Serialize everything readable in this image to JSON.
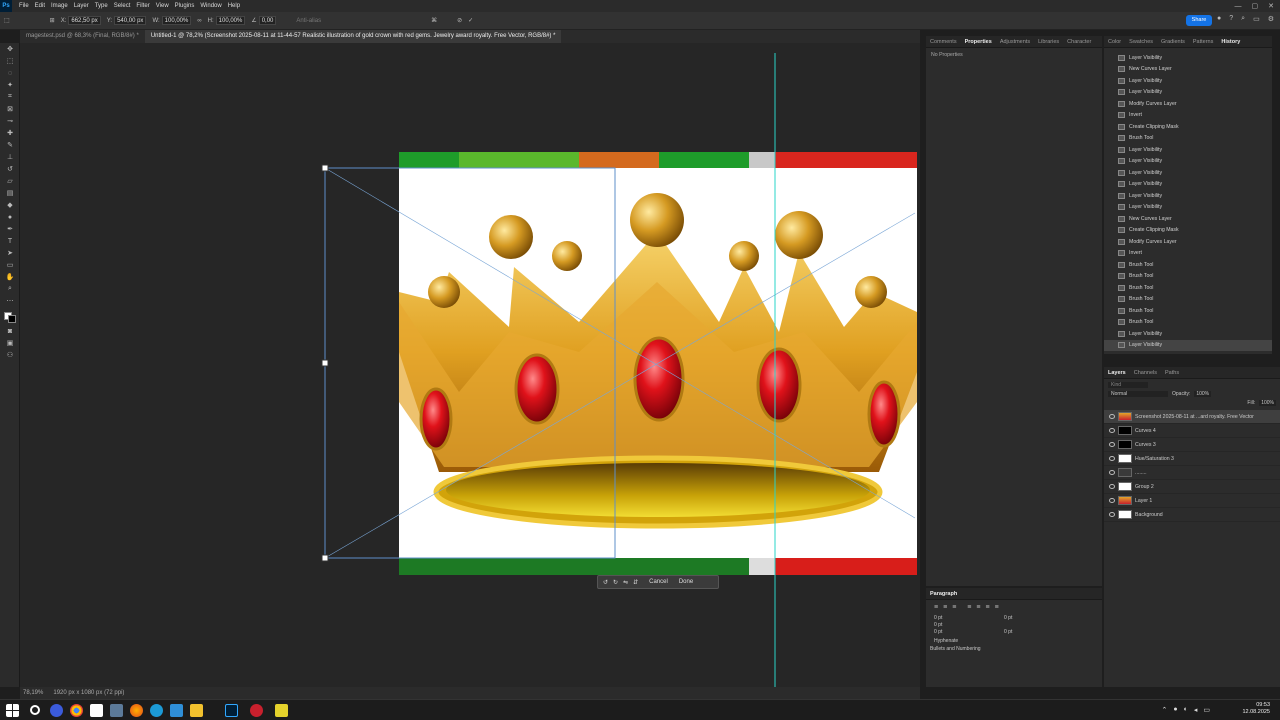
{
  "menu": {
    "app_badge": "Ps",
    "items": [
      "File",
      "Edit",
      "Image",
      "Layer",
      "Type",
      "Select",
      "Filter",
      "View",
      "Plugins",
      "Window",
      "Help"
    ],
    "window_controls": [
      "—",
      "▢",
      "✕"
    ]
  },
  "options": {
    "x_label": "X:",
    "x_value": "662,50 px",
    "y_label": "Y:",
    "y_value": "540,00 px",
    "w_label": "W:",
    "w_value": "100,00%",
    "h_label": "H:",
    "h_value": "100,00%",
    "angle_value": "0,00",
    "interp": "Anti-alias",
    "share": "Share"
  },
  "tabs": [
    "magestest.psd @ 68,3% (Final, RGB/8#) *",
    "Untitled-1 @ 78,2% (Screenshot 2025-08-11 at 11-44-57 Realistic illustration of gold crown with red gems. Jewelry award royalty. Free Vector, RGB/8#) *"
  ],
  "transform": {
    "cancel": "Cancel",
    "done": "Done"
  },
  "status": {
    "zoom": "78,19%",
    "size": "1920 px x 1080 px (72 ppi)"
  },
  "props_tabs": [
    "Comments",
    "Properties",
    "Adjustments",
    "Libraries",
    "Character"
  ],
  "props_active": "Properties",
  "props_text": "No Properties",
  "history_tabs": [
    "Color",
    "Swatches",
    "Gradients",
    "Patterns",
    "History"
  ],
  "history_active": "History",
  "history": [
    "Layer Visibility",
    "New Curves Layer",
    "Layer Visibility",
    "Layer Visibility",
    "Modify Curves Layer",
    "Invert",
    "Create Clipping Mask",
    "Brush Tool",
    "Layer Visibility",
    "Layer Visibility",
    "Layer Visibility",
    "Layer Visibility",
    "Layer Visibility",
    "Layer Visibility",
    "New Curves Layer",
    "Create Clipping Mask",
    "Modify Curves Layer",
    "Invert",
    "Brush Tool",
    "Brush Tool",
    "Brush Tool",
    "Brush Tool",
    "Brush Tool",
    "Brush Tool",
    "Layer Visibility",
    "Layer Visibility"
  ],
  "layers_tabs": [
    "Layers",
    "Channels",
    "Paths"
  ],
  "layers_search": "Kind",
  "blend": "Normal",
  "opacity_label": "Opacity:",
  "opacity": "100%",
  "fill_label": "Fill:",
  "fill": "100%",
  "layers": [
    {
      "name": "Screenshot 2025-08-11 at ...ard royalty. Free Vector",
      "thumb": "img",
      "sel": true
    },
    {
      "name": "Curves 4",
      "thumb": "dark",
      "sel": false
    },
    {
      "name": "Curves 3",
      "thumb": "dark",
      "sel": false
    },
    {
      "name": "Hue/Saturation 3",
      "thumb": "white",
      "sel": false
    },
    {
      "name": "........",
      "thumb": "icon",
      "sel": false
    },
    {
      "name": "Group 2",
      "thumb": "white",
      "sel": false
    },
    {
      "name": "Layer 1",
      "thumb": "img",
      "sel": false
    },
    {
      "name": "Background",
      "thumb": "white",
      "sel": false
    }
  ],
  "paragraph": {
    "title": "Paragraph",
    "fields": [
      "0 pt",
      "0 pt",
      "0 pt",
      "0 pt",
      "0 pt",
      "0 pt"
    ],
    "hyphenate": "Hyphenate",
    "bullets": "Bullets and Numbering"
  },
  "clock": {
    "time": "09:53",
    "date": "12.08.2025"
  }
}
